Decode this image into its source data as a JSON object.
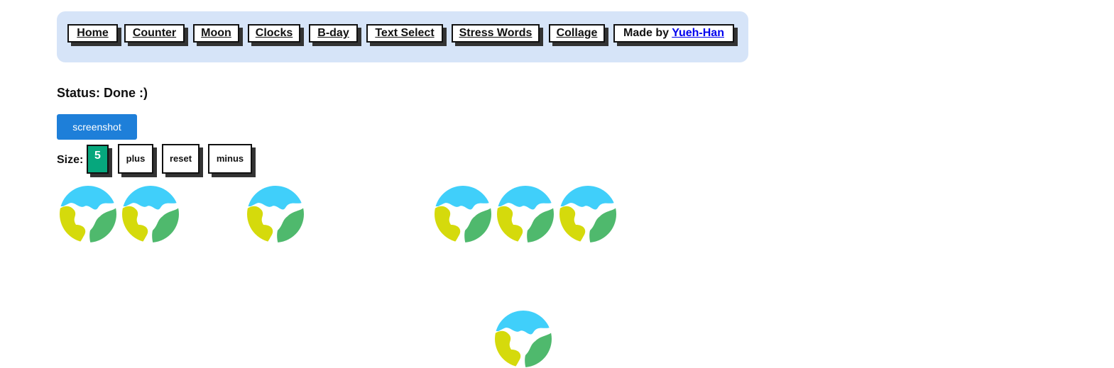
{
  "nav": {
    "items": [
      {
        "label": "Home"
      },
      {
        "label": "Counter"
      },
      {
        "label": "Moon"
      },
      {
        "label": "Clocks"
      },
      {
        "label": "B-day"
      },
      {
        "label": "Text Select"
      },
      {
        "label": "Stress Words"
      },
      {
        "label": "Collage"
      }
    ],
    "made_by_prefix": "Made by ",
    "made_by_link": "Yueh-Han"
  },
  "status": {
    "text": "Status: Done :)"
  },
  "screenshot_button": "screenshot",
  "size": {
    "label": "Size:",
    "value": "5",
    "plus": "plus",
    "reset": "reset",
    "minus": "minus"
  },
  "icons": {
    "earth": "earth-globe-icon"
  },
  "colors": {
    "nav_bg": "#d6e4f8",
    "button_blue": "#1e7fd9",
    "size_green": "#06a77d",
    "earth_water": "#40cffa",
    "earth_yellow": "#d5da0c",
    "earth_green": "#4fb96d",
    "link": "#0000ee"
  }
}
